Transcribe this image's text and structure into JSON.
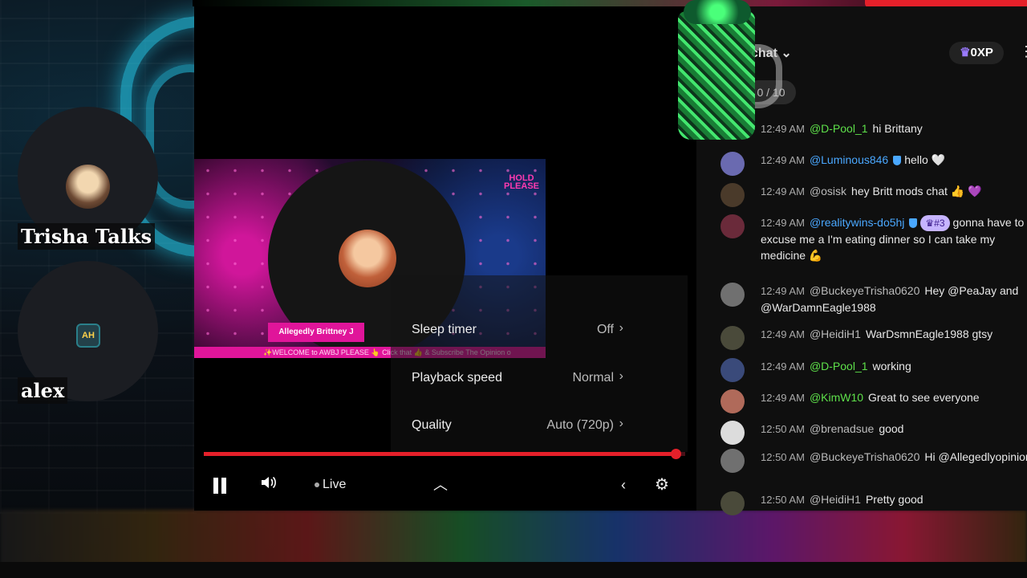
{
  "participants": [
    {
      "name": "Trisha Talks"
    },
    {
      "name": "alex",
      "avatar_text": "AH"
    }
  ],
  "stream": {
    "hold_text": "HOLD PLEASE",
    "name_tag": "Allegedly Brittney J",
    "ticker": "✨WELCOME to AWBJ PLEASE 👆 Click that 👍 & Subscribe   The Opinion o"
  },
  "settings_menu": {
    "items": [
      {
        "label": "Sleep timer",
        "value": "Off"
      },
      {
        "label": "Playback speed",
        "value": "Normal"
      },
      {
        "label": "Quality",
        "value": "Auto (720p)"
      }
    ]
  },
  "player_controls": {
    "live_label": "Live",
    "progress": 0.98,
    "accent_color": "#e5202a"
  },
  "chat": {
    "title": "chat",
    "xp": "0XP",
    "counter": "0 / 10",
    "messages": [
      {
        "time": "12:49 AM",
        "user": "@D-Pool_1",
        "user_color": "green",
        "text": "hi Brittany"
      },
      {
        "time": "12:49 AM",
        "user": "@Luminous846",
        "user_color": "blue",
        "text": "hello 🤍"
      },
      {
        "time": "12:49 AM",
        "user": "@osisk",
        "user_color": "grey",
        "text": "hey Britt mods chat 👍 💜"
      },
      {
        "time": "12:49 AM",
        "user": "@realitywins-do5hj",
        "user_color": "blue",
        "rank": "#3",
        "text": "gonna have to excuse me a I'm eating dinner so I can take my medicine 💪"
      },
      {
        "time": "12:49 AM",
        "user": "@BuckeyeTrisha0620",
        "user_color": "grey",
        "text": "Hey @PeaJay and @WarDamnEagle1988"
      },
      {
        "time": "12:49 AM",
        "user": "@HeidiH1",
        "user_color": "grey",
        "text": "WarDsmnEagle1988 gtsy"
      },
      {
        "time": "12:49 AM",
        "user": "@D-Pool_1",
        "user_color": "green",
        "text": "working"
      },
      {
        "time": "12:49 AM",
        "user": "@KimW10",
        "user_color": "green",
        "text": "Great to see everyone"
      },
      {
        "time": "12:50 AM",
        "user": "@brenadsue",
        "user_color": "grey",
        "text": "good"
      },
      {
        "time": "12:50 AM",
        "user": "@BuckeyeTrisha0620",
        "user_color": "grey",
        "text": "Hi @Allegedlyopinion"
      },
      {
        "time": "12:50 AM",
        "user": "@HeidiH1",
        "user_color": "grey",
        "text": "Pretty good"
      }
    ]
  }
}
